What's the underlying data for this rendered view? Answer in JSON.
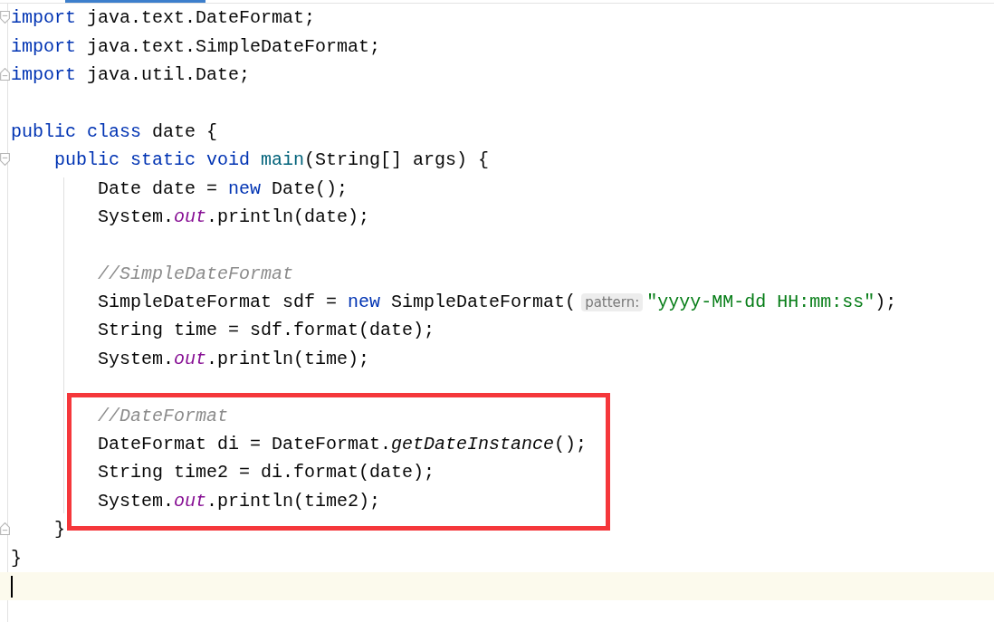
{
  "editor": {
    "blocks": [
      {
        "boxed": false,
        "lines": [
          {
            "fold_start": true,
            "fold_end": false,
            "current": false,
            "tokens": [
              {
                "kind": "keyword",
                "text": "import"
              },
              {
                "kind": "plain",
                "text": " java.text.DateFormat;"
              }
            ]
          },
          {
            "fold_start": false,
            "fold_end": false,
            "current": false,
            "tokens": [
              {
                "kind": "keyword",
                "text": "import"
              },
              {
                "kind": "plain",
                "text": " java.text.SimpleDateFormat;"
              }
            ]
          },
          {
            "fold_start": false,
            "fold_end": true,
            "current": false,
            "tokens": [
              {
                "kind": "keyword",
                "text": "import"
              },
              {
                "kind": "plain",
                "text": " java.util.Date;"
              }
            ]
          },
          {
            "fold_start": false,
            "fold_end": false,
            "current": false
          },
          {
            "fold_start": false,
            "fold_end": false,
            "current": false,
            "tokens": [
              {
                "kind": "keyword",
                "text": "public class"
              },
              {
                "kind": "plain",
                "text": " date {"
              }
            ]
          },
          {
            "fold_start": true,
            "fold_end": false,
            "current": false,
            "tokens": [
              {
                "kind": "keyword",
                "text": "    public static void "
              },
              {
                "kind": "declaration",
                "text": "main"
              },
              {
                "kind": "plain",
                "text": "(String[] args) {"
              }
            ]
          },
          {
            "fold_start": false,
            "fold_end": false,
            "current": false,
            "tokens": [
              {
                "kind": "plain",
                "text": "        Date date = "
              },
              {
                "kind": "keyword",
                "text": "new"
              },
              {
                "kind": "plain",
                "text": " Date();"
              }
            ]
          },
          {
            "fold_start": false,
            "fold_end": false,
            "current": false,
            "tokens": [
              {
                "kind": "plain",
                "text": "        System."
              },
              {
                "kind": "field",
                "text": "out"
              },
              {
                "kind": "plain",
                "text": ".println(date);"
              }
            ]
          },
          {
            "fold_start": false,
            "fold_end": false,
            "current": false
          },
          {
            "fold_start": false,
            "fold_end": false,
            "current": false,
            "tokens": [
              {
                "kind": "comment",
                "text": "        //SimpleDateFormat"
              }
            ]
          },
          {
            "fold_start": false,
            "fold_end": false,
            "current": false,
            "tokens": [
              {
                "kind": "plain",
                "text": "        SimpleDateFormat sdf = "
              },
              {
                "kind": "keyword",
                "text": "new"
              },
              {
                "kind": "plain",
                "text": " SimpleDateFormat("
              },
              {
                "kind": "hint",
                "text": "pattern:"
              },
              {
                "kind": "string",
                "text": "\"yyyy-MM-dd HH:mm:ss\""
              },
              {
                "kind": "plain",
                "text": ");"
              }
            ]
          },
          {
            "fold_start": false,
            "fold_end": false,
            "current": false,
            "tokens": [
              {
                "kind": "plain",
                "text": "        String time = sdf.format(date);"
              }
            ]
          },
          {
            "fold_start": false,
            "fold_end": false,
            "current": false,
            "tokens": [
              {
                "kind": "plain",
                "text": "        System."
              },
              {
                "kind": "field",
                "text": "out"
              },
              {
                "kind": "plain",
                "text": ".println(time);"
              }
            ]
          },
          {
            "fold_start": false,
            "fold_end": false,
            "current": false
          }
        ]
      },
      {
        "boxed": true,
        "lines": [
          {
            "fold_start": false,
            "fold_end": false,
            "current": false,
            "tokens": [
              {
                "kind": "comment",
                "text": "        //DateFormat"
              }
            ]
          },
          {
            "fold_start": false,
            "fold_end": false,
            "current": false,
            "tokens": [
              {
                "kind": "plain",
                "text": "        DateFormat di = DateFormat."
              },
              {
                "kind": "static-call",
                "text": "getDateInstance"
              },
              {
                "kind": "plain",
                "text": "();"
              }
            ]
          },
          {
            "fold_start": false,
            "fold_end": false,
            "current": false,
            "tokens": [
              {
                "kind": "plain",
                "text": "        String time2 = di.format(date);"
              }
            ]
          },
          {
            "fold_start": false,
            "fold_end": false,
            "current": false,
            "tokens": [
              {
                "kind": "plain",
                "text": "        System."
              },
              {
                "kind": "field",
                "text": "out"
              },
              {
                "kind": "plain",
                "text": ".println(time2);"
              }
            ]
          }
        ]
      },
      {
        "boxed": false,
        "lines": [
          {
            "fold_start": false,
            "fold_end": true,
            "current": false,
            "tokens": [
              {
                "kind": "plain",
                "text": "    }"
              }
            ]
          },
          {
            "fold_start": false,
            "fold_end": false,
            "current": false,
            "tokens": [
              {
                "kind": "plain",
                "text": "}"
              }
            ]
          },
          {
            "fold_start": false,
            "fold_end": false,
            "current": true
          }
        ]
      }
    ]
  }
}
